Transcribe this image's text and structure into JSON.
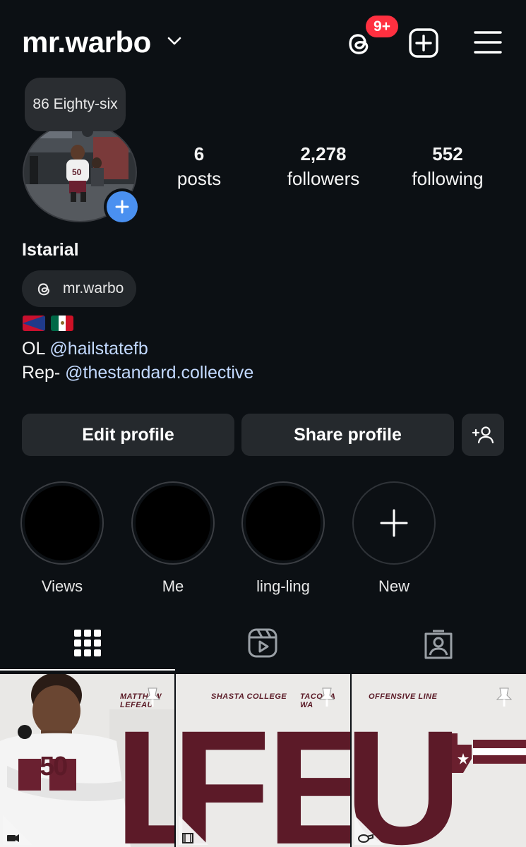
{
  "header": {
    "username": "mr.warbo",
    "notification_count": "9+"
  },
  "profile": {
    "note": "86 Eighty-six",
    "stats": [
      {
        "num": "6",
        "label": "posts"
      },
      {
        "num": "2,278",
        "label": "followers"
      },
      {
        "num": "552",
        "label": "following"
      }
    ],
    "display_name": "Istarial",
    "threads_handle": "mr.warbo",
    "flags": [
      "american-samoa-flag",
      "mexico-flag"
    ],
    "bio": {
      "line1_prefix": "OL ",
      "line1_link": "@hailstatefb",
      "line2_prefix": "Rep- ",
      "line2_link": "@thestandard.collective"
    }
  },
  "buttons": {
    "edit": "Edit profile",
    "share": "Share profile"
  },
  "highlights": [
    {
      "label": "Views"
    },
    {
      "label": "Me"
    },
    {
      "label": "ling-ling"
    },
    {
      "label": "New"
    }
  ],
  "tabs": [
    "grid-icon",
    "reels-icon",
    "tagged-icon"
  ],
  "posts": {
    "tile1_label": "MATTHEW LEFEAU",
    "tile2_label": "SHASTA COLLEGE",
    "tile2_label_b": "TACOMA WA",
    "tile3_label": "OFFENSIVE LINE",
    "tile1_letters": "LE",
    "tile2_letters": "FEA",
    "tile3_letters": "U",
    "jersey_number": "50"
  },
  "colors": {
    "background": "#0c1014",
    "badge": "#ff3040",
    "link": "#c2d9ff",
    "maroon": "#5c1a28",
    "add_blue": "#4a90f0"
  }
}
